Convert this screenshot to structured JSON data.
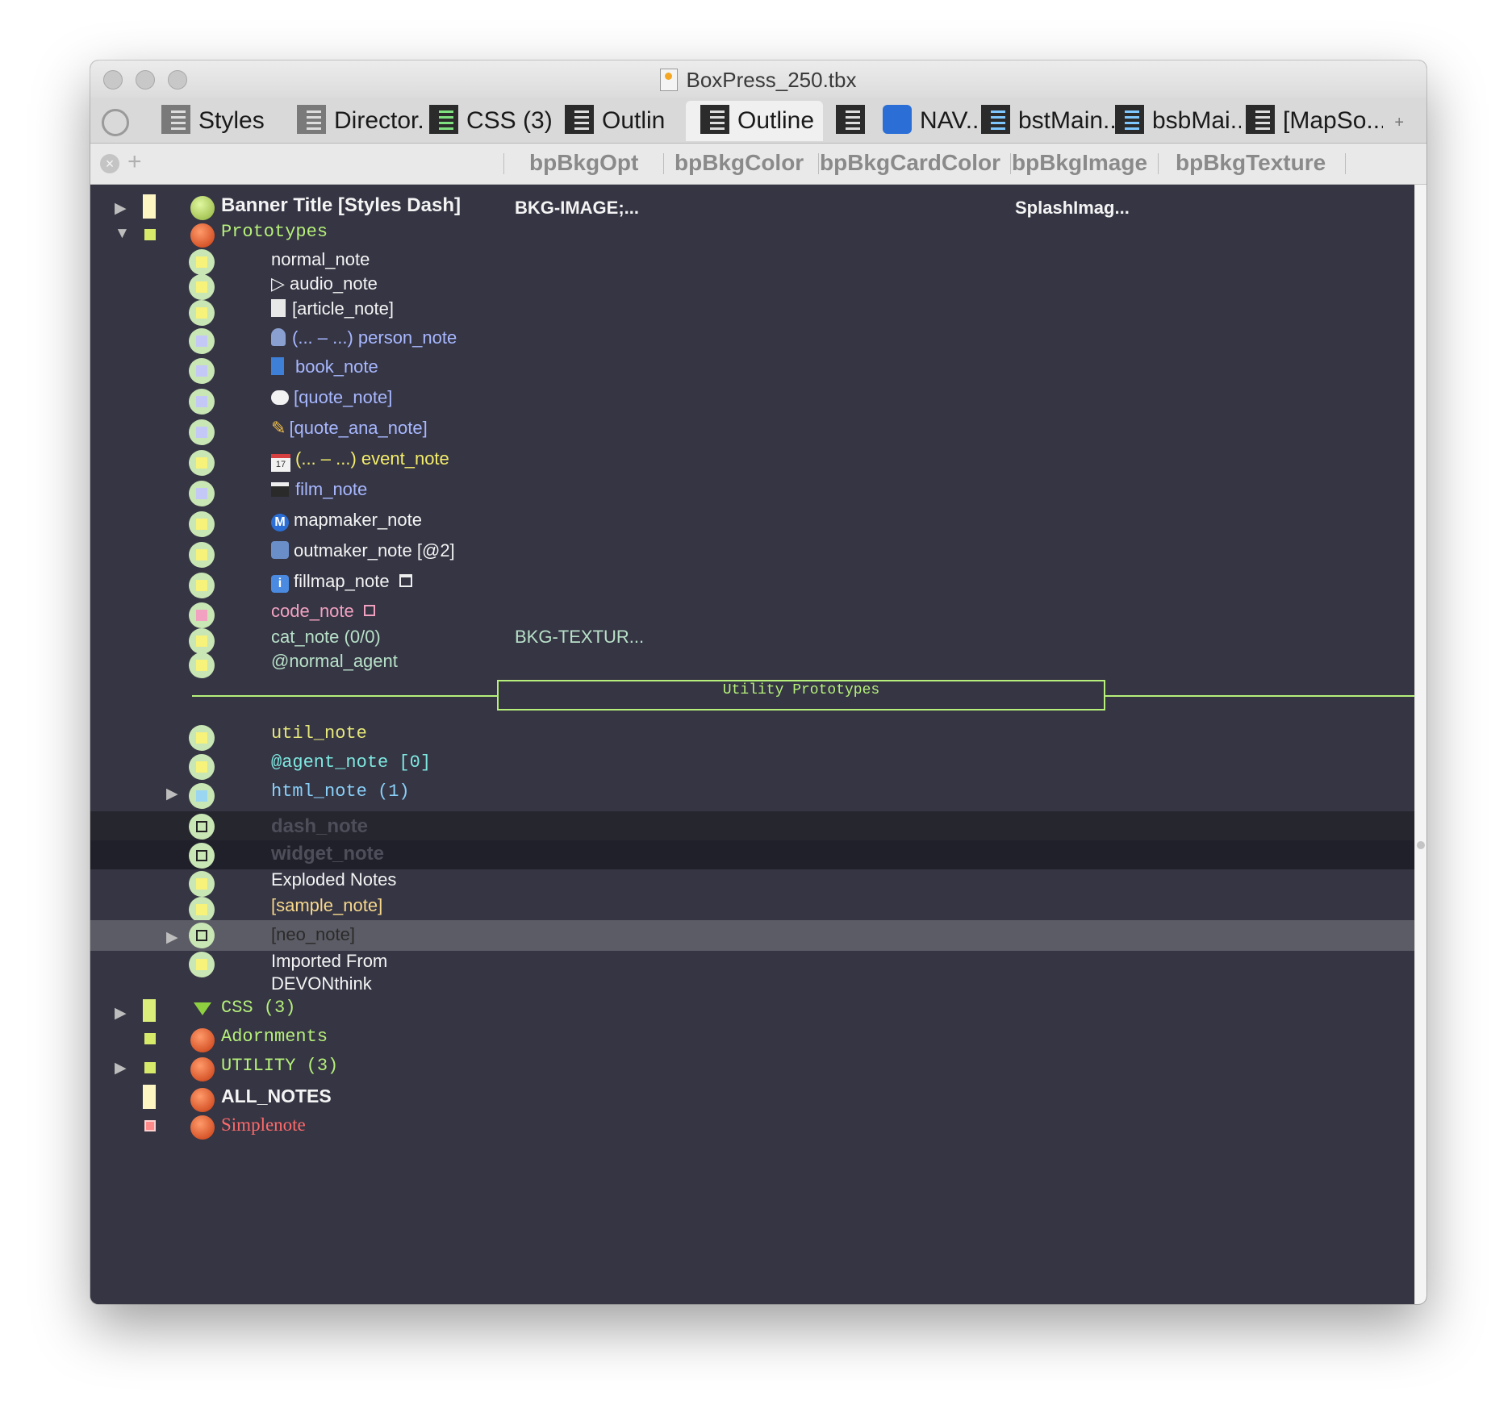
{
  "window": {
    "title": "BoxPress_250.tbx"
  },
  "tabs": [
    {
      "label": "Styles",
      "icon": "grey-outline-icon"
    },
    {
      "label": "Director...",
      "icon": "grey-outline-icon"
    },
    {
      "label": "CSS (3)",
      "icon": "green-outline-icon"
    },
    {
      "label": "Outlin",
      "icon": "outline-icon"
    },
    {
      "label": "Outline",
      "icon": "outline-icon",
      "active": true
    },
    {
      "label": "NAV...",
      "icon": "nav-arrows-icon"
    },
    {
      "label": "bstMain...",
      "icon": "blue-outline-icon"
    },
    {
      "label": "bsbMai...",
      "icon": "blue-outline-icon"
    },
    {
      "label": "[MapSo...",
      "icon": "map-icon"
    }
  ],
  "tab_add": "+",
  "columns": [
    "bpBkgOpt",
    "bpBkgColor",
    "bpBkgCardColor",
    "bpBkgImage",
    "bpBkgTexture"
  ],
  "col_add": "+",
  "rows": {
    "banner": {
      "label": "Banner Title [Styles Dash]",
      "col1": "BKG-IMAGE;...",
      "col2": "SplashImag..."
    },
    "prototypes": {
      "label": "Prototypes"
    },
    "normal_note": "normal_note",
    "audio_note": "audio_note",
    "article_note": "[article_note]",
    "person_note": "(... – ...) person_note",
    "book_note": "book_note",
    "quote_note": "[quote_note]",
    "quote_ana_note": "[quote_ana_note]",
    "event_note": "(... – ...) event_note",
    "film_note": "film_note",
    "mapmaker_note": "mapmaker_note",
    "outmaker_note": "outmaker_note [@2]",
    "fillmap_note": "fillmap_note",
    "code_note": "code_note",
    "cat_note": {
      "label": "cat_note (0/0)",
      "col1": "BKG-TEXTUR..."
    },
    "normal_agent": "@normal_agent",
    "separator": "Utility Prototypes",
    "util_note": "util_note",
    "agent_note": "@agent_note [0]",
    "html_note": "html_note (1)",
    "dash_note": "dash_note",
    "widget_note": "widget_note",
    "exploded": "Exploded Notes",
    "sample_note": "[sample_note]",
    "neo_note": "[neo_note]",
    "imported_1": "Imported From",
    "imported_2": "DEVONthink",
    "css": "CSS (3)",
    "adornments": "Adornments",
    "utility": "UTILITY (3)",
    "all_notes": "ALL_NOTES",
    "simplenote": "Simplenote"
  },
  "glyphs": {
    "mapmaker_badge": "M",
    "event_day": "17",
    "fillmap_info": "i"
  },
  "colors": {
    "background": "#353544",
    "green_text": "#b6f07a",
    "blue_text": "#a8b8ff",
    "yellow_text": "#f4ed6a",
    "pink_text": "#f2a2c0",
    "mint_text": "#b8e0c8",
    "red_text": "#ff6a6a"
  }
}
